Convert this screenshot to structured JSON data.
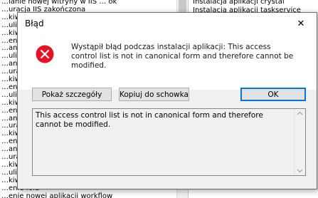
{
  "background": {
    "left_lines": [
      "…ianie nowej witryny w IIS … ok",
      "…uracja IIS zakończona",
      "…kiwanie",
      "…uli aplikacji",
      "…kiwanie",
      "…enie fold",
      "…anie no",
      "…uli aplikacji",
      "…anie no",
      "…uracja",
      "…kiwanie",
      "…enie fold",
      "…uli apl",
      "…kiwanie",
      "…enie fold",
      "…anie pu",
      "…uracja",
      "…kiwanie",
      "…enie fold",
      "…anie pu",
      "…uracja",
      "…kiwanie",
      "…uli apl",
      "…kiwanie",
      "…enie fold",
      "…enie nowej aplikacji workflow"
    ],
    "right_lines": [
      "Instalacja aplikacji crystal",
      "Instalacja aplikacji taskservice"
    ]
  },
  "dialog": {
    "title": "Błąd",
    "close_glyph": "✕",
    "message": "Wystąpił błąd podczas instalacji aplikacji: This access control list is not in canonical form and therefore cannot be modified.",
    "buttons": {
      "details": "Pokaż szczegóły",
      "copy": "Kopiuj do schowka",
      "ok": "OK"
    },
    "details_text": "This access control list is not in canonical form and therefore cannot be modified.",
    "icon": "error-icon",
    "colors": {
      "error_red": "#e81123",
      "focus_blue": "#0078d7"
    }
  }
}
